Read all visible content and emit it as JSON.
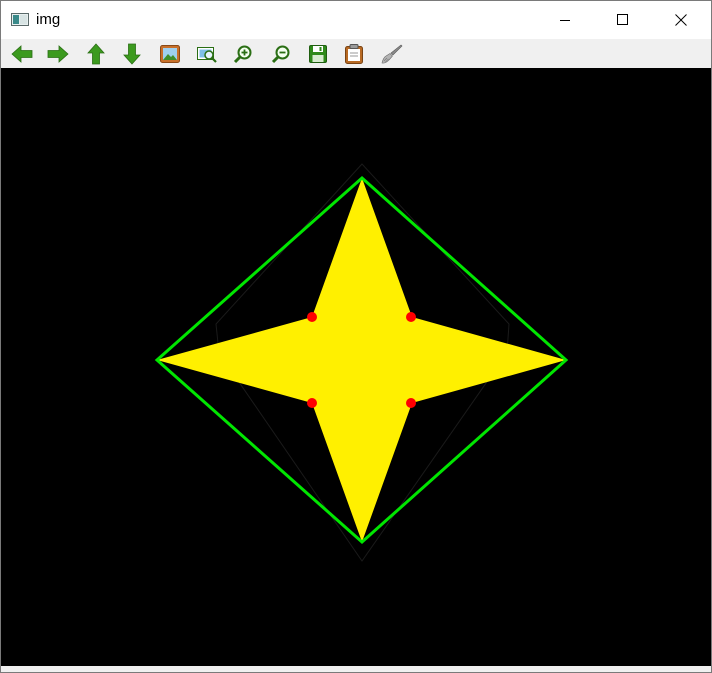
{
  "window": {
    "title": "img"
  },
  "toolbar": {
    "buttons": [
      {
        "name": "pan-left",
        "icon": "arrow-left-icon"
      },
      {
        "name": "pan-right",
        "icon": "arrow-right-icon"
      },
      {
        "name": "pan-up",
        "icon": "arrow-up-icon"
      },
      {
        "name": "pan-down",
        "icon": "arrow-down-icon"
      },
      {
        "name": "zoom-original",
        "icon": "image-icon"
      },
      {
        "name": "zoom-fit",
        "icon": "zoom-fit-icon"
      },
      {
        "name": "zoom-in",
        "icon": "zoom-in-icon"
      },
      {
        "name": "zoom-out",
        "icon": "zoom-out-icon"
      },
      {
        "name": "save",
        "icon": "save-icon"
      },
      {
        "name": "copy",
        "icon": "clipboard-icon"
      },
      {
        "name": "properties",
        "icon": "brush-icon"
      }
    ]
  },
  "colors": {
    "shape_fill": "#FFF000",
    "hull": "#00E600",
    "points": "#FF0000",
    "background": "#000000"
  }
}
